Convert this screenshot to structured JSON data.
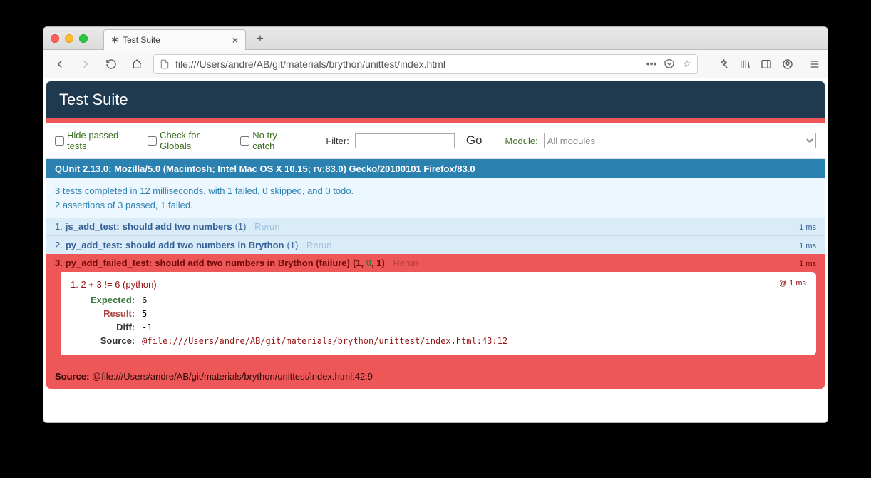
{
  "browser": {
    "tab_title": "Test Suite",
    "url": "file:///Users/andre/AB/git/materials/brython/unittest/index.html"
  },
  "qunit": {
    "header": "Test Suite",
    "toolbar": {
      "hide_passed_label": "Hide passed tests",
      "check_globals_label": "Check for Globals",
      "no_trycatch_label": "No try-catch",
      "filter_label": "Filter:",
      "go_label": "Go",
      "module_label": "Module:",
      "module_selected": "All modules"
    },
    "ua": "QUnit 2.13.0; Mozilla/5.0 (Macintosh; Intel Mac OS X 10.15; rv:83.0) Gecko/20100101 Firefox/83.0",
    "summary_line1": "3 tests completed in 12 milliseconds, with 1 failed, 0 skipped, and 0 todo.",
    "summary_line2": "2 assertions of 3 passed, 1 failed.",
    "tests": [
      {
        "index": "1.",
        "module": "js_add_test:",
        "name": "should add two numbers",
        "count": "(1)",
        "rerun": "Rerun",
        "time": "1 ms"
      },
      {
        "index": "2.",
        "module": "py_add_test:",
        "name": "should add two numbers in Brython",
        "count": "(1)",
        "rerun": "Rerun",
        "time": "1 ms"
      }
    ],
    "failed": {
      "index": "3.",
      "module": "py_add_failed_test:",
      "name": "should add two numbers in Brython (failure)",
      "count_open": "(",
      "count_a": "1",
      "count_pass": "0",
      "count_b": "1",
      "count_close": ")",
      "rerun": "Rerun",
      "time": "1 ms",
      "assertion_index": "1.",
      "assertion_msg": "2 + 3 != 6 (python)",
      "at": "@ 1 ms",
      "expected_label": "Expected:",
      "expected_value": "6",
      "result_label": "Result:",
      "result_value": "5",
      "diff_label": "Diff:",
      "diff_value": "-1",
      "source_label": "Source:",
      "source_value": "@file:///Users/andre/AB/git/materials/brython/unittest/index.html:43:12"
    },
    "outer_source_label": "Source:",
    "outer_source_value": "@file:///Users/andre/AB/git/materials/brython/unittest/index.html:42:9"
  }
}
